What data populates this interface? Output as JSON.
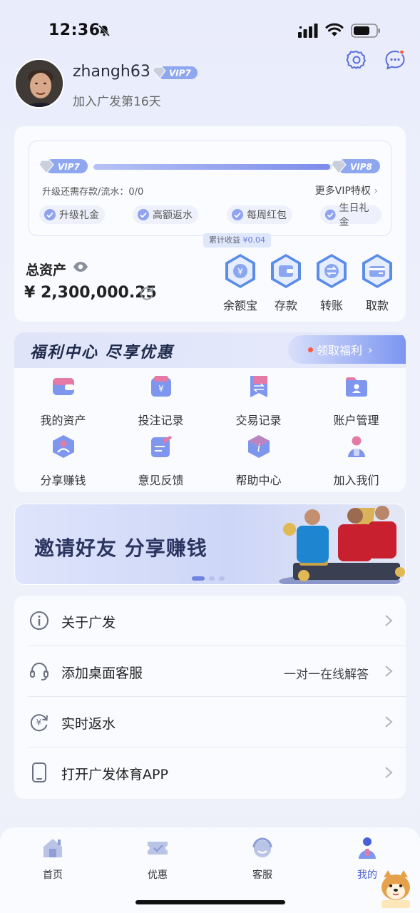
{
  "status": {
    "time": "12:36"
  },
  "profile": {
    "username": "zhangh63",
    "vip_level": "VIP7",
    "join_text": "加入广发第16天"
  },
  "vip": {
    "current": "VIP7",
    "next": "VIP8",
    "progress": 0.99,
    "upgrade_text": "升级还需存款/流水：0/0",
    "more_link": "更多VIP特权",
    "perks": [
      "升级礼金",
      "高额返水",
      "每周红包",
      "生日礼金"
    ],
    "earnings_label": "累计收益",
    "earnings_value": "¥0.04"
  },
  "assets": {
    "label": "总资产",
    "value": "¥ 2,300,000.25"
  },
  "quick_actions": [
    {
      "label": "余额宝",
      "icon": "yen-coin-icon"
    },
    {
      "label": "存款",
      "icon": "wallet-icon"
    },
    {
      "label": "转账",
      "icon": "transfer-icon"
    },
    {
      "label": "取款",
      "icon": "card-icon"
    }
  ],
  "welfare": {
    "title": "福利中心 尽享优惠",
    "claim_label": "领取福利",
    "items": [
      {
        "label": "我的资产",
        "icon": "wallet-icon"
      },
      {
        "label": "投注记录",
        "icon": "bet-record-icon"
      },
      {
        "label": "交易记录",
        "icon": "transaction-icon"
      },
      {
        "label": "账户管理",
        "icon": "folder-user-icon"
      },
      {
        "label": "分享赚钱",
        "icon": "share-icon"
      },
      {
        "label": "意见反馈",
        "icon": "feedback-icon"
      },
      {
        "label": "帮助中心",
        "icon": "info-icon"
      },
      {
        "label": "加入我们",
        "icon": "person-icon"
      }
    ]
  },
  "banner": {
    "text": "邀请好友 分享赚钱",
    "slides": 3,
    "active_slide": 1
  },
  "menu": [
    {
      "label": "关于广发",
      "right": "",
      "icon": "info-circle-icon"
    },
    {
      "label": "添加桌面客服",
      "right": "一对一在线解答",
      "icon": "headset-icon"
    },
    {
      "label": "实时返水",
      "right": "",
      "icon": "yen-refresh-icon"
    },
    {
      "label": "打开广发体育APP",
      "right": "",
      "icon": "phone-icon"
    }
  ],
  "tabs": [
    {
      "label": "首页",
      "icon": "home-icon",
      "active": false
    },
    {
      "label": "优惠",
      "icon": "ticket-icon",
      "active": false
    },
    {
      "label": "客服",
      "icon": "support-icon",
      "active": false
    },
    {
      "label": "我的",
      "icon": "profile-icon",
      "active": true
    }
  ],
  "colors": {
    "accent": "#4a5fd6",
    "background": "#eef0fb",
    "card": "#fafbff",
    "vip_gradient": "#7d8cea",
    "claim_dot": "#ff5a3c"
  }
}
